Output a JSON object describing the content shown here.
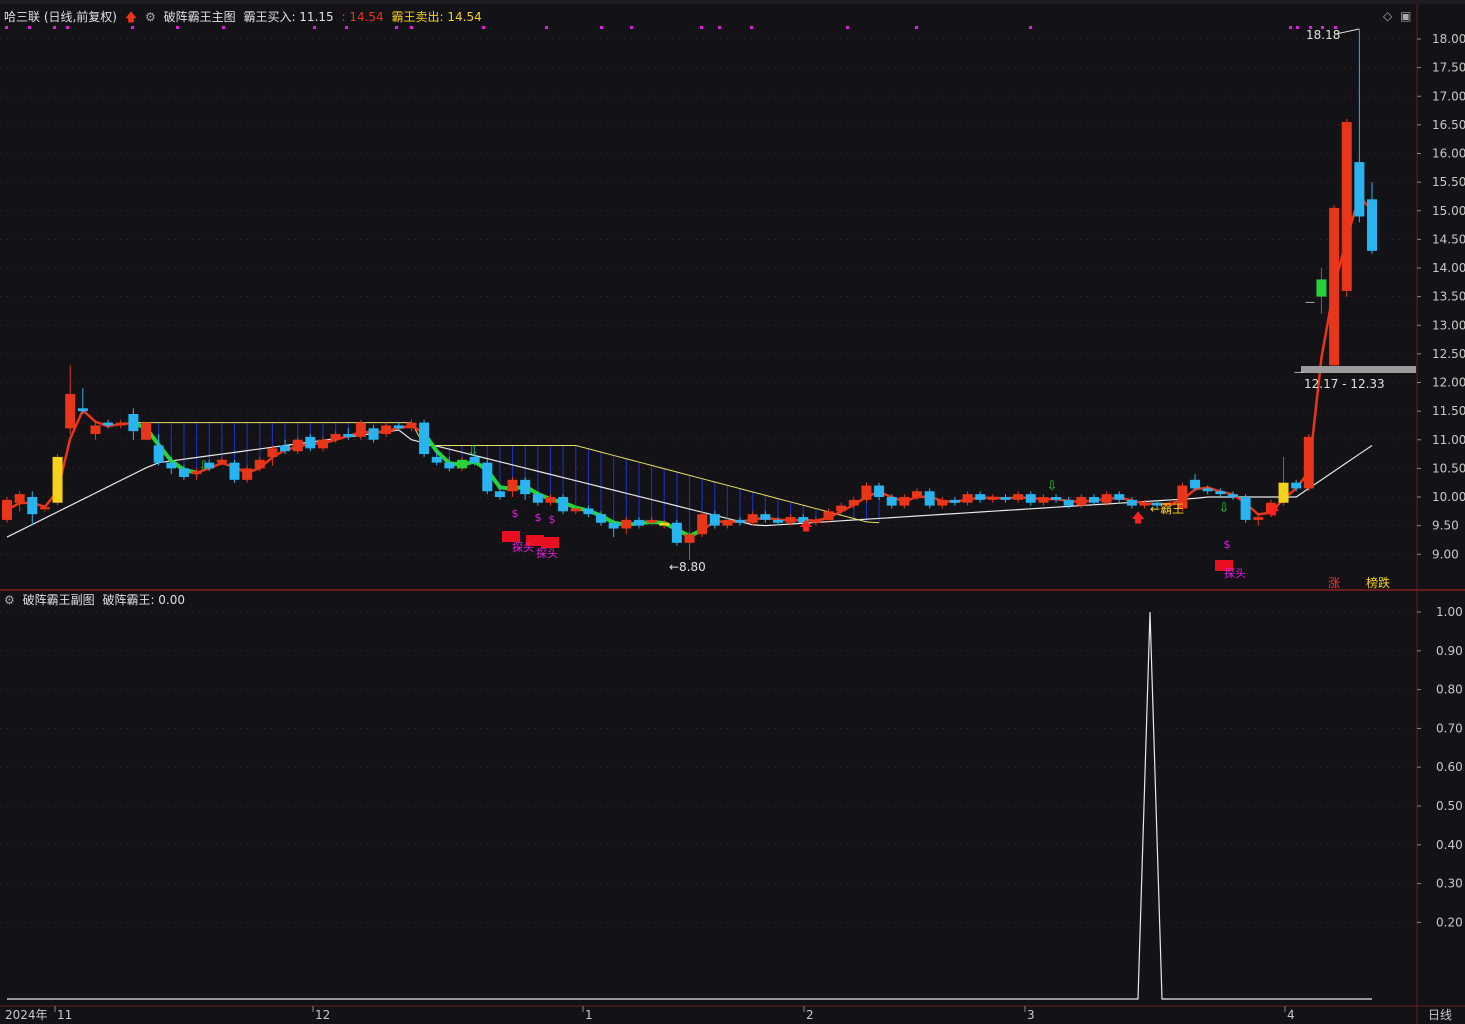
{
  "header": {
    "stock_title": "哈三联 (日线,前复权)",
    "main_indicator": "破阵霸王主图",
    "buy_label": "霸王买入: 11.15",
    "mid_value": ": 14.54",
    "sell_label": "霸王卖出: 14.54"
  },
  "sub_header": {
    "indicator": "破阵霸王副图",
    "value_label": "破阵霸王: 0.00"
  },
  "price_axis": [
    "18.00",
    "17.50",
    "17.00",
    "16.50",
    "16.00",
    "15.50",
    "15.00",
    "14.50",
    "14.00",
    "13.50",
    "13.00",
    "12.50",
    "12.00",
    "11.50",
    "11.00",
    "10.50",
    "10.00",
    "9.50",
    "9.00"
  ],
  "sub_axis": [
    "1.00",
    "0.90",
    "0.80",
    "0.70",
    "0.60",
    "0.50",
    "0.40",
    "0.30",
    "0.20"
  ],
  "time_axis": {
    "year": "2024年",
    "months": [
      {
        "label": "11"
      },
      {
        "label": "12"
      },
      {
        "label": "1"
      },
      {
        "label": "2"
      },
      {
        "label": "3"
      },
      {
        "label": "4"
      }
    ],
    "period_button": "日线"
  },
  "annotations": {
    "high_label": "18.18",
    "low_label": "←8.80",
    "range_label": "12.17 - 12.33",
    "dash_label": "—",
    "bawang_label": "←霸王",
    "dollar": "$",
    "tantou": "探头",
    "zhang": "涨",
    "bangdie": "榜跌"
  },
  "colors": {
    "bg": "#131216",
    "up": "#e8361a",
    "down": "#27b4f0",
    "green": "#28d23a",
    "yellow": "#f7d21b",
    "grid": "#3a1818",
    "magenta": "#e020e0",
    "white_line": "#e8e8e8",
    "axis_text": "#c8c8c8"
  },
  "chart_data": {
    "type": "candlestick",
    "price_range": [
      8.6,
      18.4
    ],
    "candles": [
      [
        9.6,
        9.95,
        9.55,
        10.0
      ],
      [
        9.9,
        10.05,
        9.75,
        10.1
      ],
      [
        10.0,
        9.7,
        9.5,
        10.1
      ],
      [
        9.8,
        9.82,
        9.75,
        9.85
      ],
      [
        9.9,
        10.7,
        9.85,
        10.75
      ],
      [
        11.2,
        11.8,
        11.1,
        12.3
      ],
      [
        11.55,
        11.5,
        11.45,
        11.9
      ],
      [
        11.1,
        11.25,
        11.0,
        11.3
      ],
      [
        11.3,
        11.25,
        11.2,
        11.35
      ],
      [
        11.25,
        11.3,
        11.2,
        11.35
      ],
      [
        11.45,
        11.15,
        11.0,
        11.55
      ],
      [
        11.0,
        11.3,
        11.0,
        11.3
      ],
      [
        10.9,
        10.6,
        10.55,
        11.1
      ],
      [
        10.6,
        10.5,
        10.4,
        10.7
      ],
      [
        10.5,
        10.35,
        10.3,
        10.55
      ],
      [
        10.4,
        10.45,
        10.3,
        10.5
      ],
      [
        10.6,
        10.5,
        10.45,
        10.65
      ],
      [
        10.6,
        10.65,
        10.55,
        10.7
      ],
      [
        10.6,
        10.3,
        10.25,
        10.65
      ],
      [
        10.3,
        10.5,
        10.25,
        10.55
      ],
      [
        10.5,
        10.65,
        10.45,
        10.7
      ],
      [
        10.7,
        10.85,
        10.55,
        10.9
      ],
      [
        10.9,
        10.8,
        10.75,
        11.0
      ],
      [
        10.8,
        11.0,
        10.75,
        11.05
      ],
      [
        11.05,
        10.85,
        10.8,
        11.1
      ],
      [
        10.85,
        11.0,
        10.8,
        11.05
      ],
      [
        11.0,
        11.1,
        10.95,
        11.15
      ],
      [
        11.1,
        11.05,
        11.0,
        11.2
      ],
      [
        11.05,
        11.3,
        11.0,
        11.35
      ],
      [
        11.2,
        11.0,
        10.95,
        11.25
      ],
      [
        11.1,
        11.25,
        11.05,
        11.3
      ],
      [
        11.25,
        11.2,
        11.15,
        11.3
      ],
      [
        11.2,
        11.3,
        11.15,
        11.35
      ],
      [
        11.3,
        10.75,
        10.7,
        11.35
      ],
      [
        10.7,
        10.6,
        10.55,
        10.8
      ],
      [
        10.6,
        10.5,
        10.45,
        10.7
      ],
      [
        10.5,
        10.65,
        10.45,
        10.7
      ],
      [
        10.7,
        10.6,
        10.55,
        10.75
      ],
      [
        10.6,
        10.1,
        10.05,
        10.65
      ],
      [
        10.1,
        10.0,
        9.95,
        10.2
      ],
      [
        10.1,
        10.3,
        10.0,
        10.35
      ],
      [
        10.3,
        10.05,
        9.95,
        10.35
      ],
      [
        10.05,
        9.9,
        9.85,
        10.1
      ],
      [
        9.9,
        10.0,
        9.85,
        10.05
      ],
      [
        10.0,
        9.75,
        9.7,
        10.05
      ],
      [
        9.75,
        9.8,
        9.7,
        9.85
      ],
      [
        9.8,
        9.7,
        9.65,
        9.85
      ],
      [
        9.7,
        9.55,
        9.5,
        9.75
      ],
      [
        9.55,
        9.45,
        9.3,
        9.6
      ],
      [
        9.45,
        9.6,
        9.35,
        9.65
      ],
      [
        9.6,
        9.5,
        9.45,
        9.65
      ],
      [
        9.55,
        9.6,
        9.5,
        9.65
      ],
      [
        9.5,
        9.55,
        9.45,
        9.6
      ],
      [
        9.55,
        9.2,
        9.15,
        9.6
      ],
      [
        9.2,
        9.35,
        8.9,
        9.4
      ],
      [
        9.35,
        9.7,
        9.3,
        9.75
      ],
      [
        9.7,
        9.5,
        9.45,
        9.75
      ],
      [
        9.5,
        9.6,
        9.45,
        9.65
      ],
      [
        9.6,
        9.55,
        9.5,
        9.65
      ],
      [
        9.55,
        9.7,
        9.5,
        9.75
      ],
      [
        9.7,
        9.6,
        9.55,
        9.75
      ],
      [
        9.6,
        9.55,
        9.5,
        9.65
      ],
      [
        9.55,
        9.65,
        9.5,
        9.7
      ],
      [
        9.65,
        9.55,
        9.5,
        9.7
      ],
      [
        9.55,
        9.6,
        9.5,
        9.65
      ],
      [
        9.6,
        9.75,
        9.55,
        9.8
      ],
      [
        9.75,
        9.85,
        9.7,
        9.9
      ],
      [
        9.85,
        9.95,
        9.8,
        10.0
      ],
      [
        9.95,
        10.2,
        9.9,
        10.25
      ],
      [
        10.2,
        10.0,
        9.95,
        10.25
      ],
      [
        10.0,
        9.85,
        9.8,
        10.05
      ],
      [
        9.85,
        10.0,
        9.8,
        10.05
      ],
      [
        10.0,
        10.1,
        9.95,
        10.15
      ],
      [
        10.1,
        9.85,
        9.8,
        10.15
      ],
      [
        9.85,
        9.95,
        9.8,
        10.0
      ],
      [
        9.95,
        9.9,
        9.85,
        10.0
      ],
      [
        9.9,
        10.05,
        9.85,
        10.1
      ],
      [
        10.05,
        9.95,
        9.9,
        10.1
      ],
      [
        9.95,
        10.0,
        9.9,
        10.05
      ],
      [
        10.0,
        9.95,
        9.9,
        10.05
      ],
      [
        9.95,
        10.05,
        9.9,
        10.1
      ],
      [
        10.05,
        9.9,
        9.85,
        10.1
      ],
      [
        9.9,
        10.0,
        9.85,
        10.05
      ],
      [
        10.0,
        9.95,
        9.9,
        10.05
      ],
      [
        9.95,
        9.85,
        9.8,
        10.0
      ],
      [
        9.85,
        10.0,
        9.8,
        10.05
      ],
      [
        10.0,
        9.9,
        9.85,
        10.05
      ],
      [
        9.9,
        10.05,
        9.85,
        10.1
      ],
      [
        10.05,
        9.95,
        9.9,
        10.1
      ],
      [
        9.95,
        9.85,
        9.8,
        10.0
      ],
      [
        9.85,
        9.9,
        9.8,
        9.95
      ],
      [
        9.9,
        9.85,
        9.8,
        9.95
      ],
      [
        9.85,
        9.9,
        9.8,
        9.95
      ],
      [
        9.8,
        10.2,
        9.75,
        10.25
      ],
      [
        10.3,
        10.15,
        10.1,
        10.4
      ],
      [
        10.15,
        10.1,
        10.05,
        10.2
      ],
      [
        10.1,
        10.05,
        10.0,
        10.15
      ],
      [
        10.05,
        10.0,
        9.95,
        10.1
      ],
      [
        10.0,
        9.6,
        9.55,
        10.05
      ],
      [
        9.6,
        9.65,
        9.5,
        9.7
      ],
      [
        9.7,
        9.9,
        9.65,
        9.95
      ],
      [
        9.9,
        10.25,
        9.85,
        10.7
      ],
      [
        10.25,
        10.15,
        10.1,
        10.3
      ],
      [
        10.15,
        11.05,
        10.1,
        11.1
      ],
      [
        13.5,
        13.8,
        13.2,
        14.0
      ],
      [
        12.3,
        15.05,
        12.2,
        15.1
      ],
      [
        13.6,
        16.55,
        13.5,
        16.6
      ],
      [
        15.85,
        14.9,
        14.8,
        18.18
      ],
      [
        15.2,
        14.3,
        14.25,
        15.5
      ]
    ],
    "sub_series_peak": 1.0
  }
}
